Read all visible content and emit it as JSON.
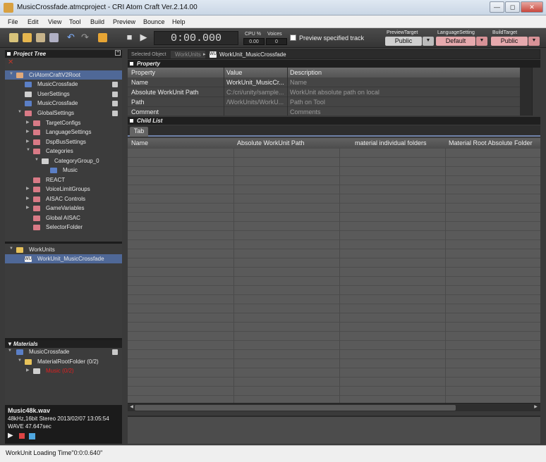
{
  "window": {
    "title": "MusicCrossfade.atmcproject - CRI Atom Craft Ver.2.14.00",
    "minimize_glyph": "—",
    "maximize_glyph": "◻",
    "close_glyph": "✕"
  },
  "menu": [
    "File",
    "Edit",
    "View",
    "Tool",
    "Build",
    "Preview",
    "Bounce",
    "Help"
  ],
  "toolbar": {
    "timecode": "0:00.000",
    "cpu_label": "CPU %",
    "cpu_value": "0.00",
    "voices_label": "Voices",
    "voices_value": "0",
    "preview_specified_label": "Preview specified track",
    "preview_target_label": "PreviewTarget",
    "preview_target_value": "Public",
    "language_setting_label": "LanguageSetting",
    "language_setting_value": "Default",
    "build_target_label": "BuildTarget",
    "build_target_value": "Public",
    "dropdown_glyph": "▼",
    "stop_glyph": "■",
    "play_glyph": "▶",
    "undo_glyph": "↶",
    "redo_glyph": "↷"
  },
  "project_tree": {
    "header": "Project Tree",
    "collapse_glyph": "−",
    "delete_glyph": "✕",
    "items": [
      {
        "label": "CriAtomCraftV2Root"
      },
      {
        "label": "MusicCrossfade"
      },
      {
        "label": "UserSettings"
      },
      {
        "label": "MusicCrossfade"
      },
      {
        "label": "GlobalSettings"
      },
      {
        "label": "TargetConfigs"
      },
      {
        "label": "LanguageSettings"
      },
      {
        "label": "DspBusSettings"
      },
      {
        "label": "Categories"
      },
      {
        "label": "CategoryGroup_0"
      },
      {
        "label": "Music"
      },
      {
        "label": "REACT"
      },
      {
        "label": "VoiceLimitGroups"
      },
      {
        "label": "AISAC Controls"
      },
      {
        "label": "GameVariables"
      },
      {
        "label": "Global AISAC"
      },
      {
        "label": "SelectorFolder"
      }
    ]
  },
  "workunits": {
    "items": [
      {
        "label": "WorkUnits"
      },
      {
        "label": "WorkUnit_MusicCrossfade",
        "icon_text": "WU"
      }
    ]
  },
  "materials": {
    "header": "Materials",
    "items": [
      {
        "label": "MusicCrossfade"
      },
      {
        "label": "MaterialRootFolder  (0/2)"
      },
      {
        "label": "Music  (0/2)"
      }
    ]
  },
  "material_info": {
    "filename": "Music48k.wav",
    "format": "48kHz,16bit Stereo   2013/02/07 13:05:54",
    "duration": "WAVE 47.647sec",
    "play_glyph": "▶"
  },
  "breadcrumb": {
    "selected_label": "Selected Object",
    "crumb1": "WorkUnits",
    "separator": "▸",
    "crumb2": "WorkUnit_MusicCrossfade",
    "icon_text": "WU"
  },
  "property": {
    "header": "Property",
    "columns": [
      "Property",
      "Value",
      "Description"
    ],
    "rows": [
      {
        "name": "Name",
        "value": "WorkUnit_MusicCr...",
        "desc": "Name"
      },
      {
        "name": "Absolute WorkUnit Path",
        "value": "C:/cri/unity/sample...",
        "desc": "WorkUnit absolute path on local"
      },
      {
        "name": "Path",
        "value": "/WorkUnits/WorkU...",
        "desc": "Path on Tool"
      },
      {
        "name": "Comment",
        "value": "",
        "desc": "Comments"
      }
    ]
  },
  "child_list": {
    "header": "Child List",
    "tab": "Tab",
    "columns": [
      "Name",
      "Absolute WorkUnit Path",
      "material individual folders",
      "Material Root Absolute Folder"
    ],
    "left_arrow": "◀",
    "right_arrow": "▶"
  },
  "status": {
    "text": "WorkUnit Loading Time\"0:0:0.640\""
  }
}
